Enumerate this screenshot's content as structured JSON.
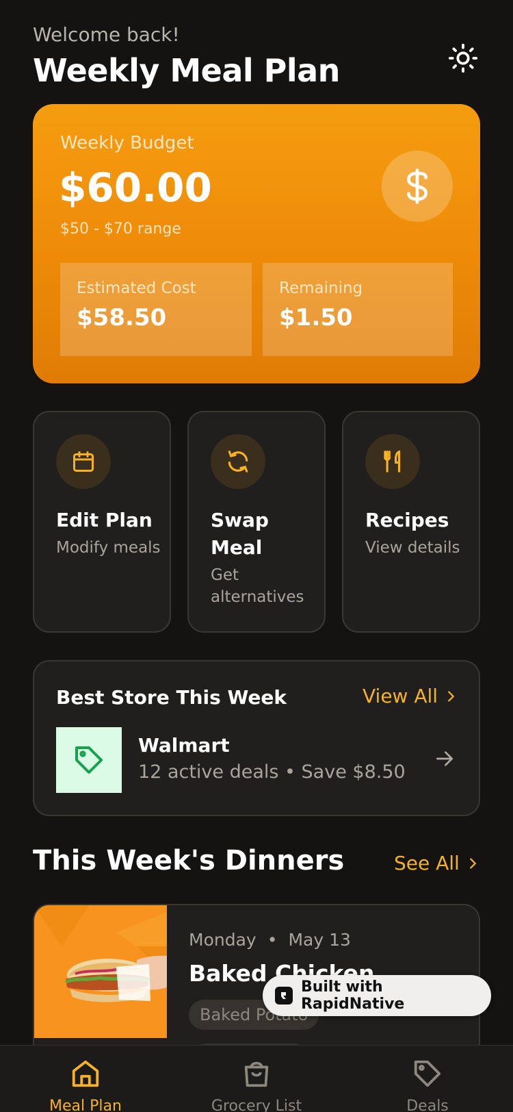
{
  "header": {
    "welcome": "Welcome back!",
    "title": "Weekly Meal Plan",
    "theme_icon": "sun-icon"
  },
  "budget": {
    "label": "Weekly Budget",
    "amount": "$60.00",
    "range": "$50 - $70 range",
    "icon": "dollar-icon",
    "estimated_label": "Estimated Cost",
    "estimated_value": "$58.50",
    "remaining_label": "Remaining",
    "remaining_value": "$1.50",
    "accent": "#f59d10"
  },
  "actions": [
    {
      "title": "Edit Plan",
      "subtitle": "Modify meals",
      "icon": "calendar-icon"
    },
    {
      "title": "Swap Meal",
      "subtitle": "Get alternatives",
      "icon": "refresh-icon"
    },
    {
      "title": "Recipes",
      "subtitle": "View details",
      "icon": "utensils-icon"
    }
  ],
  "store": {
    "heading": "Best Store This Week",
    "view_all": "View All",
    "name": "Walmart",
    "meta": "12 active deals • Save $8.50",
    "icon": "tag-icon"
  },
  "dinners": {
    "title": "This Week's Dinners",
    "see_all": "See All",
    "items": [
      {
        "day": "Monday",
        "date": "May 13",
        "name": "Baked Chicken",
        "tags": [
          "Baked Potato"
        ]
      }
    ]
  },
  "badge": {
    "text": "Built with RapidNative"
  },
  "nav": [
    {
      "label": "Meal Plan",
      "icon": "home-icon",
      "active": true
    },
    {
      "label": "Grocery List",
      "icon": "shopping-bag-icon",
      "active": false
    },
    {
      "label": "Deals",
      "icon": "tag-icon",
      "active": false
    }
  ]
}
